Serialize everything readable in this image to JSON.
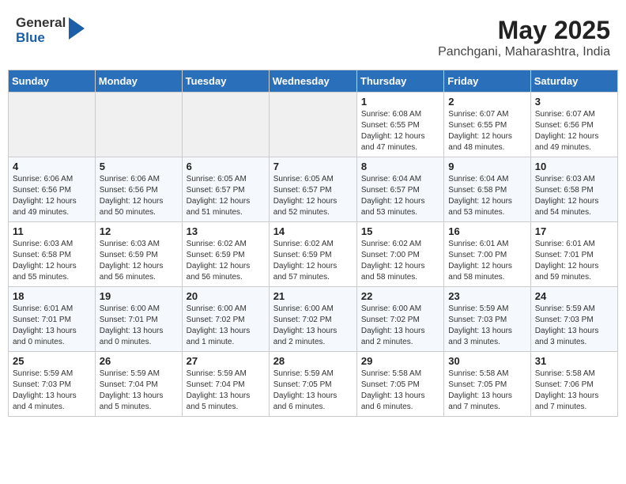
{
  "header": {
    "logo_general": "General",
    "logo_blue": "Blue",
    "title": "May 2025",
    "subtitle": "Panchgani, Maharashtra, India"
  },
  "days_of_week": [
    "Sunday",
    "Monday",
    "Tuesday",
    "Wednesday",
    "Thursday",
    "Friday",
    "Saturday"
  ],
  "weeks": [
    [
      {
        "day": "",
        "detail": ""
      },
      {
        "day": "",
        "detail": ""
      },
      {
        "day": "",
        "detail": ""
      },
      {
        "day": "",
        "detail": ""
      },
      {
        "day": "1",
        "detail": "Sunrise: 6:08 AM\nSunset: 6:55 PM\nDaylight: 12 hours\nand 47 minutes."
      },
      {
        "day": "2",
        "detail": "Sunrise: 6:07 AM\nSunset: 6:55 PM\nDaylight: 12 hours\nand 48 minutes."
      },
      {
        "day": "3",
        "detail": "Sunrise: 6:07 AM\nSunset: 6:56 PM\nDaylight: 12 hours\nand 49 minutes."
      }
    ],
    [
      {
        "day": "4",
        "detail": "Sunrise: 6:06 AM\nSunset: 6:56 PM\nDaylight: 12 hours\nand 49 minutes."
      },
      {
        "day": "5",
        "detail": "Sunrise: 6:06 AM\nSunset: 6:56 PM\nDaylight: 12 hours\nand 50 minutes."
      },
      {
        "day": "6",
        "detail": "Sunrise: 6:05 AM\nSunset: 6:57 PM\nDaylight: 12 hours\nand 51 minutes."
      },
      {
        "day": "7",
        "detail": "Sunrise: 6:05 AM\nSunset: 6:57 PM\nDaylight: 12 hours\nand 52 minutes."
      },
      {
        "day": "8",
        "detail": "Sunrise: 6:04 AM\nSunset: 6:57 PM\nDaylight: 12 hours\nand 53 minutes."
      },
      {
        "day": "9",
        "detail": "Sunrise: 6:04 AM\nSunset: 6:58 PM\nDaylight: 12 hours\nand 53 minutes."
      },
      {
        "day": "10",
        "detail": "Sunrise: 6:03 AM\nSunset: 6:58 PM\nDaylight: 12 hours\nand 54 minutes."
      }
    ],
    [
      {
        "day": "11",
        "detail": "Sunrise: 6:03 AM\nSunset: 6:58 PM\nDaylight: 12 hours\nand 55 minutes."
      },
      {
        "day": "12",
        "detail": "Sunrise: 6:03 AM\nSunset: 6:59 PM\nDaylight: 12 hours\nand 56 minutes."
      },
      {
        "day": "13",
        "detail": "Sunrise: 6:02 AM\nSunset: 6:59 PM\nDaylight: 12 hours\nand 56 minutes."
      },
      {
        "day": "14",
        "detail": "Sunrise: 6:02 AM\nSunset: 6:59 PM\nDaylight: 12 hours\nand 57 minutes."
      },
      {
        "day": "15",
        "detail": "Sunrise: 6:02 AM\nSunset: 7:00 PM\nDaylight: 12 hours\nand 58 minutes."
      },
      {
        "day": "16",
        "detail": "Sunrise: 6:01 AM\nSunset: 7:00 PM\nDaylight: 12 hours\nand 58 minutes."
      },
      {
        "day": "17",
        "detail": "Sunrise: 6:01 AM\nSunset: 7:01 PM\nDaylight: 12 hours\nand 59 minutes."
      }
    ],
    [
      {
        "day": "18",
        "detail": "Sunrise: 6:01 AM\nSunset: 7:01 PM\nDaylight: 13 hours\nand 0 minutes."
      },
      {
        "day": "19",
        "detail": "Sunrise: 6:00 AM\nSunset: 7:01 PM\nDaylight: 13 hours\nand 0 minutes."
      },
      {
        "day": "20",
        "detail": "Sunrise: 6:00 AM\nSunset: 7:02 PM\nDaylight: 13 hours\nand 1 minute."
      },
      {
        "day": "21",
        "detail": "Sunrise: 6:00 AM\nSunset: 7:02 PM\nDaylight: 13 hours\nand 2 minutes."
      },
      {
        "day": "22",
        "detail": "Sunrise: 6:00 AM\nSunset: 7:02 PM\nDaylight: 13 hours\nand 2 minutes."
      },
      {
        "day": "23",
        "detail": "Sunrise: 5:59 AM\nSunset: 7:03 PM\nDaylight: 13 hours\nand 3 minutes."
      },
      {
        "day": "24",
        "detail": "Sunrise: 5:59 AM\nSunset: 7:03 PM\nDaylight: 13 hours\nand 3 minutes."
      }
    ],
    [
      {
        "day": "25",
        "detail": "Sunrise: 5:59 AM\nSunset: 7:03 PM\nDaylight: 13 hours\nand 4 minutes."
      },
      {
        "day": "26",
        "detail": "Sunrise: 5:59 AM\nSunset: 7:04 PM\nDaylight: 13 hours\nand 5 minutes."
      },
      {
        "day": "27",
        "detail": "Sunrise: 5:59 AM\nSunset: 7:04 PM\nDaylight: 13 hours\nand 5 minutes."
      },
      {
        "day": "28",
        "detail": "Sunrise: 5:59 AM\nSunset: 7:05 PM\nDaylight: 13 hours\nand 6 minutes."
      },
      {
        "day": "29",
        "detail": "Sunrise: 5:58 AM\nSunset: 7:05 PM\nDaylight: 13 hours\nand 6 minutes."
      },
      {
        "day": "30",
        "detail": "Sunrise: 5:58 AM\nSunset: 7:05 PM\nDaylight: 13 hours\nand 7 minutes."
      },
      {
        "day": "31",
        "detail": "Sunrise: 5:58 AM\nSunset: 7:06 PM\nDaylight: 13 hours\nand 7 minutes."
      }
    ]
  ]
}
